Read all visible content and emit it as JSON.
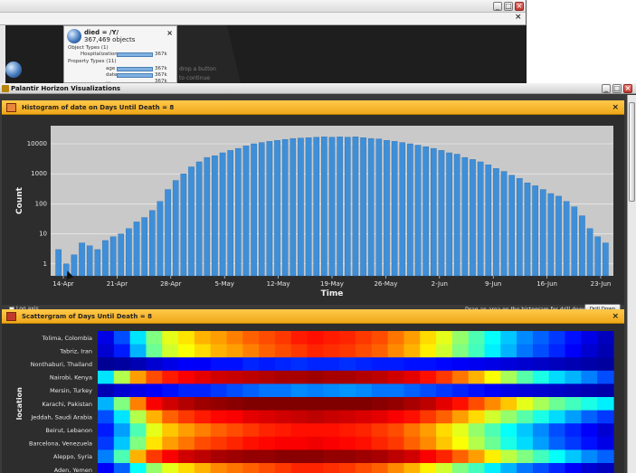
{
  "background_window": {
    "node": {
      "title": "died = /Y/",
      "count": "367,469 objects",
      "section_object_types": "Object Types (1)",
      "section_property_types": "Property Types (11)",
      "rows": [
        {
          "label": "Hospitalization",
          "value": "367k",
          "fill": 1.0
        },
        {
          "label": "age",
          "value": "367k",
          "fill": 1.0
        },
        {
          "label": "date",
          "value": "367k",
          "fill": 1.0
        },
        {
          "label": "...",
          "value": "367k",
          "fill": 1.0
        }
      ]
    },
    "drop_hint_line1": "drop a button",
    "drop_hint_line2": "to continue"
  },
  "main_window": {
    "title": "Palantir Horizon Visualizations"
  },
  "histogram": {
    "header": "Histogram of date on Days Until Death = 8",
    "log_axis_label": "Log axis",
    "drill_hint": "Drag an area on the histogram for drill down.",
    "drill_button": "Drill Down"
  },
  "scattergram": {
    "header": "Scattergram of Days Until Death = 8"
  },
  "chart_data": [
    {
      "type": "bar",
      "title": "",
      "xlabel": "Time",
      "ylabel": "Count",
      "y_scale": "log",
      "y_ticks": [
        "1",
        "10",
        "100",
        "1000",
        "10000"
      ],
      "ylim": [
        0.4,
        40000
      ],
      "x_ticks": [
        "14-Apr",
        "21-Apr",
        "28-Apr",
        "5-May",
        "12-May",
        "19-May",
        "26-May",
        "2-Jun",
        "9-Jun",
        "16-Jun",
        "23-Jun"
      ],
      "x_start": "2011-04-14",
      "grid": true,
      "bar_color": "#3f8fd8",
      "values": [
        3,
        1,
        2,
        5,
        4,
        3,
        6,
        8,
        10,
        15,
        25,
        35,
        60,
        120,
        300,
        600,
        1000,
        1700,
        2500,
        3500,
        4000,
        5000,
        6000,
        7000,
        8500,
        10000,
        11000,
        12000,
        13000,
        14000,
        15000,
        15500,
        16000,
        16500,
        17000,
        16500,
        17000,
        16500,
        17000,
        16000,
        15000,
        14500,
        13000,
        12000,
        11000,
        10000,
        9000,
        8000,
        7000,
        6000,
        5000,
        4500,
        3500,
        3000,
        2500,
        2000,
        1500,
        1200,
        900,
        700,
        500,
        400,
        300,
        220,
        180,
        120,
        80,
        40,
        15,
        8,
        5
      ]
    },
    {
      "type": "heatmap",
      "title": "",
      "ylabel": "location",
      "rows": [
        "Tolima, Colombia",
        "Tabriz, Iran",
        "Nonthaburi, Thailand",
        "Nairobi, Kenya",
        "Mersin, Turkey",
        "Karachi, Pakistan",
        "Jeddah, Saudi Arabia",
        "Beirut, Lebanon",
        "Barcelona, Venezuela",
        "Aleppo, Syria",
        "Aden, Yemen"
      ],
      "columns": 32,
      "intensity": [
        [
          0.1,
          0.2,
          0.35,
          0.5,
          0.6,
          0.65,
          0.7,
          0.72,
          0.75,
          0.78,
          0.8,
          0.82,
          0.85,
          0.86,
          0.85,
          0.84,
          0.82,
          0.8,
          0.76,
          0.72,
          0.66,
          0.6,
          0.52,
          0.45,
          0.38,
          0.32,
          0.26,
          0.22,
          0.18,
          0.14,
          0.1,
          0.06
        ],
        [
          0.08,
          0.15,
          0.3,
          0.48,
          0.58,
          0.62,
          0.66,
          0.7,
          0.72,
          0.75,
          0.78,
          0.8,
          0.82,
          0.84,
          0.83,
          0.82,
          0.8,
          0.78,
          0.74,
          0.7,
          0.64,
          0.58,
          0.5,
          0.44,
          0.36,
          0.3,
          0.24,
          0.2,
          0.16,
          0.12,
          0.08,
          0.05
        ],
        [
          0.02,
          0.03,
          0.05,
          0.08,
          0.1,
          0.12,
          0.12,
          0.14,
          0.14,
          0.16,
          0.15,
          0.16,
          0.17,
          0.16,
          0.16,
          0.17,
          0.16,
          0.15,
          0.15,
          0.14,
          0.14,
          0.13,
          0.12,
          0.11,
          0.1,
          0.09,
          0.08,
          0.07,
          0.06,
          0.05,
          0.04,
          0.03
        ],
        [
          0.35,
          0.55,
          0.72,
          0.8,
          0.85,
          0.88,
          0.9,
          0.92,
          0.93,
          0.94,
          0.95,
          0.96,
          0.96,
          0.97,
          0.96,
          0.96,
          0.95,
          0.94,
          0.92,
          0.9,
          0.86,
          0.82,
          0.76,
          0.7,
          0.62,
          0.54,
          0.46,
          0.4,
          0.34,
          0.3,
          0.25,
          0.2
        ],
        [
          0.05,
          0.08,
          0.1,
          0.12,
          0.14,
          0.16,
          0.16,
          0.18,
          0.2,
          0.22,
          0.24,
          0.24,
          0.26,
          0.25,
          0.26,
          0.27,
          0.26,
          0.24,
          0.24,
          0.22,
          0.2,
          0.18,
          0.16,
          0.14,
          0.12,
          0.1,
          0.09,
          0.08,
          0.07,
          0.06,
          0.05,
          0.04
        ],
        [
          0.3,
          0.5,
          0.75,
          0.88,
          0.92,
          0.95,
          0.97,
          0.98,
          0.99,
          1.0,
          1.0,
          1.0,
          1.0,
          1.0,
          1.0,
          1.0,
          1.0,
          0.99,
          0.98,
          0.96,
          0.94,
          0.9,
          0.86,
          0.8,
          0.74,
          0.68,
          0.6,
          0.54,
          0.48,
          0.44,
          0.4,
          0.36
        ],
        [
          0.2,
          0.35,
          0.55,
          0.7,
          0.78,
          0.82,
          0.85,
          0.87,
          0.88,
          0.9,
          0.91,
          0.92,
          0.93,
          0.94,
          0.93,
          0.92,
          0.91,
          0.9,
          0.88,
          0.86,
          0.82,
          0.78,
          0.72,
          0.66,
          0.58,
          0.52,
          0.46,
          0.4,
          0.34,
          0.28,
          0.22,
          0.18
        ],
        [
          0.15,
          0.28,
          0.45,
          0.6,
          0.68,
          0.72,
          0.75,
          0.78,
          0.8,
          0.82,
          0.84,
          0.85,
          0.86,
          0.86,
          0.86,
          0.85,
          0.84,
          0.82,
          0.8,
          0.76,
          0.72,
          0.66,
          0.6,
          0.52,
          0.45,
          0.38,
          0.32,
          0.26,
          0.2,
          0.16,
          0.12,
          0.08
        ],
        [
          0.18,
          0.32,
          0.5,
          0.65,
          0.72,
          0.76,
          0.8,
          0.82,
          0.84,
          0.86,
          0.87,
          0.88,
          0.88,
          0.89,
          0.88,
          0.87,
          0.86,
          0.84,
          0.82,
          0.78,
          0.74,
          0.68,
          0.62,
          0.55,
          0.48,
          0.4,
          0.34,
          0.28,
          0.22,
          0.18,
          0.14,
          0.1
        ],
        [
          0.25,
          0.45,
          0.7,
          0.82,
          0.88,
          0.92,
          0.94,
          0.96,
          0.97,
          0.98,
          0.98,
          0.99,
          0.99,
          0.99,
          0.98,
          0.98,
          0.97,
          0.96,
          0.94,
          0.92,
          0.88,
          0.84,
          0.78,
          0.72,
          0.64,
          0.56,
          0.5,
          0.44,
          0.38,
          0.32,
          0.26,
          0.22
        ],
        [
          0.12,
          0.22,
          0.38,
          0.52,
          0.6,
          0.66,
          0.7,
          0.74,
          0.76,
          0.78,
          0.8,
          0.82,
          0.84,
          0.84,
          0.83,
          0.82,
          0.8,
          0.78,
          0.74,
          0.7,
          0.64,
          0.58,
          0.5,
          0.44,
          0.36,
          0.3,
          0.24,
          0.2,
          0.16,
          0.12,
          0.08,
          0.06
        ]
      ]
    }
  ]
}
